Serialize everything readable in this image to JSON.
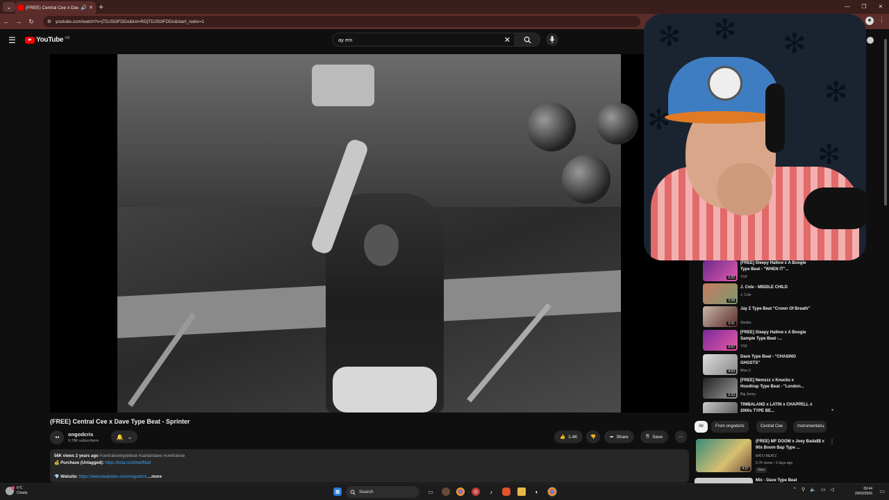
{
  "browser": {
    "tab_title": "(FREE) Central Cee x Dave",
    "url": "youtube.com/watch?v=jTDJSl3FDDo&list=RDjTDJSl3FDDo&start_radio=1"
  },
  "header": {
    "logo_text": "YouTube",
    "country_code": "GB",
    "search_value": "ay em"
  },
  "video": {
    "title": "(FREE) Central Cee x Dave Type Beat - Sprinter",
    "channel": "ongodcris",
    "subscribers": "9.78K subscribers",
    "likes": "1.4K",
    "share_label": "Share",
    "save_label": "Save"
  },
  "description": {
    "views": "56K views",
    "age": "2 years ago",
    "tags": "#centralceetypebeat #santandave #centralcee",
    "purchase_label": "Purchase (Untagged):",
    "purchase_link": "https://bsta.rs/e54a0f9a3",
    "website_label": "Website:",
    "website_link": "https://www.beatstars.com/ongodcris",
    "more_label": "...more"
  },
  "playlist": [
    {
      "title": "[FREE] Sleepy Hallow x A Boogie Type Beat - \"WHEN IT\"...",
      "channel": "YGF",
      "duration": "2:22"
    },
    {
      "title": "J. Cole - MIDDLE CHILD",
      "channel": "J. Cole",
      "duration": "3:39"
    },
    {
      "title": "Jay Z Type Beat \"Crown Of Breath\"",
      "channel": "Skrebs",
      "duration": "3:31"
    },
    {
      "title": "[FREE] Sleepy Hallow x A Boogie Sample Type Beat -...",
      "channel": "YGF",
      "duration": "2:57"
    },
    {
      "title": "Dave Type Beat - \"CHASING GHOSTS\"",
      "channel": "Bliss II",
      "duration": "4:53"
    },
    {
      "title": "[FREE] Nemzzz x Knucks x Hoodtrap Type Beat - \"London...",
      "channel": "Big Jenny",
      "duration": "2:23"
    },
    {
      "title": "TIMBALAND x LATIN x CHAPPELL x 2000s TYPE BE...",
      "channel": "",
      "duration": ""
    }
  ],
  "chips": [
    "All",
    "From ongodcris",
    "Central Cee",
    "Instrumentals"
  ],
  "recommendation": {
    "title": "(FREE) MF DOOM x Joey Bada$$ x 90s Boom Bap Type ...",
    "channel": "BATO BEATZ",
    "meta": "6.7K views • 2 days ago",
    "badge": "New",
    "duration": "4:37"
  },
  "recommendation2_title": "Mix - Dave Type Beat",
  "taskbar": {
    "temp": "6°C",
    "condition": "Cloudy",
    "search_label": "Search",
    "time": "09:44",
    "date": "29/03/2026"
  },
  "colors": {
    "accent": "#ff0000",
    "link": "#3ea6ff",
    "chrome": "#5b2d2a"
  }
}
